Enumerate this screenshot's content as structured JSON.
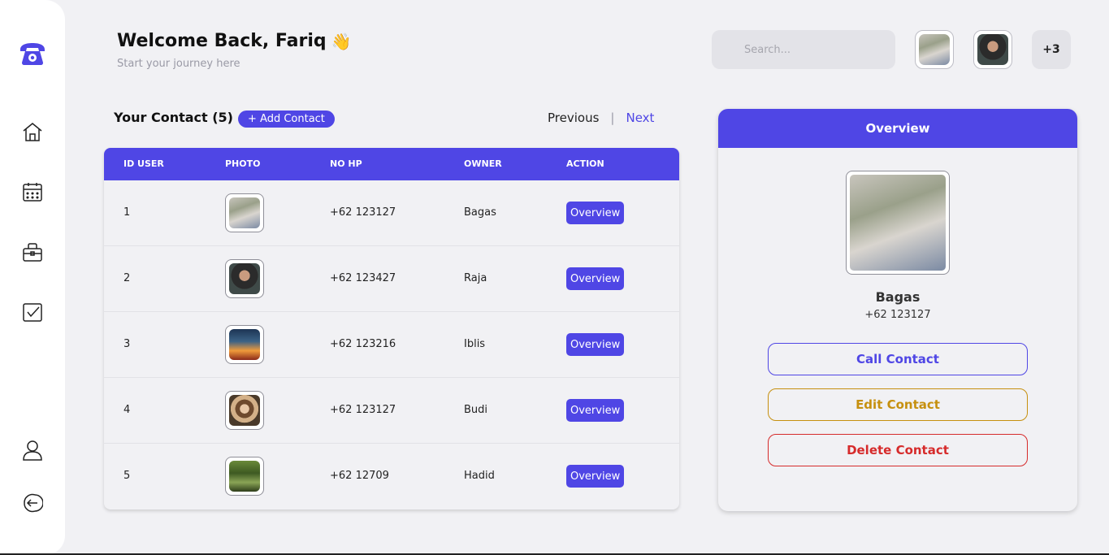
{
  "header": {
    "welcome": "Welcome Back, Fariq",
    "wave": "👋",
    "subtitle": "Start your journey here",
    "search_placeholder": "Search...",
    "avatars": [
      "street-woman-photo",
      "man-portrait-photo"
    ],
    "extra_count": "+3"
  },
  "sidebar": {
    "items": [
      "phone-logo-icon",
      "home-icon",
      "calendar-icon",
      "briefcase-icon",
      "checkbox-icon",
      "user-icon",
      "logout-icon"
    ]
  },
  "contacts": {
    "title": "Your Contact (5)",
    "add_label": "+ Add Contact",
    "previous": "Previous",
    "separator": "|",
    "next": "Next",
    "columns": [
      "ID USER",
      "PHOTO",
      "NO HP",
      "OWNER",
      "ACTION"
    ],
    "rows": [
      {
        "id": "1",
        "photo": "street-woman-photo",
        "phone": "+62 123127",
        "owner": "Bagas",
        "action": "Overview"
      },
      {
        "id": "2",
        "photo": "man-portrait-photo",
        "phone": "+62 123427",
        "owner": "Raja",
        "action": "Overview"
      },
      {
        "id": "3",
        "photo": "sunset-silhouette-photo",
        "phone": "+62 123216",
        "owner": "Iblis",
        "action": "Overview"
      },
      {
        "id": "4",
        "photo": "woman-cafe-photo",
        "phone": "+62 123127",
        "owner": "Budi",
        "action": "Overview"
      },
      {
        "id": "5",
        "photo": "forest-photo",
        "phone": "+62 12709",
        "owner": "Hadid",
        "action": "Overview"
      }
    ]
  },
  "overview": {
    "title": "Overview",
    "name": "Bagas",
    "phone": "+62 123127",
    "call_label": "Call Contact",
    "edit_label": "Edit Contact",
    "delete_label": "Delete Contact"
  },
  "colors": {
    "accent": "#4f46e5",
    "edit": "#c6900f",
    "delete": "#d62b2b",
    "background": "#f1f1f4"
  }
}
